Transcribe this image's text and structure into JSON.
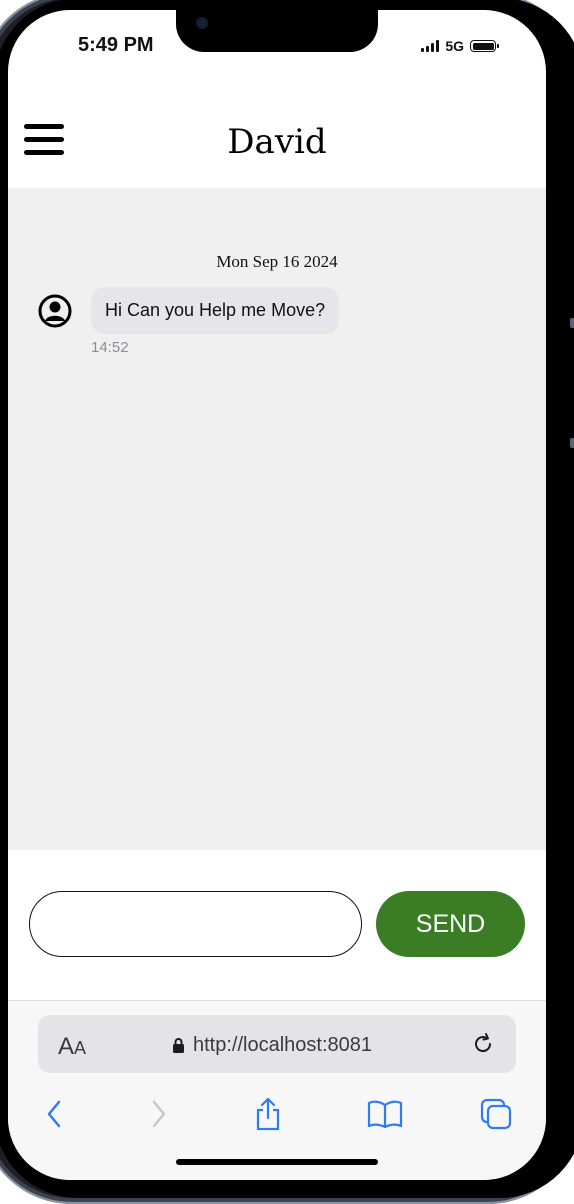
{
  "status_bar": {
    "time": "5:49 PM",
    "network": "5G",
    "icons": [
      "signal-bars-icon",
      "battery-icon"
    ]
  },
  "header": {
    "title": "David",
    "menu_icon": "hamburger-menu-icon"
  },
  "chat": {
    "date_separator": "Mon Sep 16 2024",
    "messages": [
      {
        "avatar_icon": "user-circle-icon",
        "text": "Hi Can you Help me Move?",
        "time": "14:52"
      }
    ]
  },
  "composer": {
    "input_value": "",
    "send_label": "SEND"
  },
  "browser": {
    "text_size_label_big": "A",
    "text_size_label_small": "A",
    "url": "http://localhost:8081",
    "toolbar_icons": [
      "back-icon",
      "forward-icon",
      "share-icon",
      "bookmarks-icon",
      "tabs-icon"
    ]
  },
  "colors": {
    "send_button": "#3a7d24",
    "chat_background": "#f0f0f0",
    "bubble_background": "#e5e5ea",
    "browser_accent": "#2f7bf5"
  }
}
